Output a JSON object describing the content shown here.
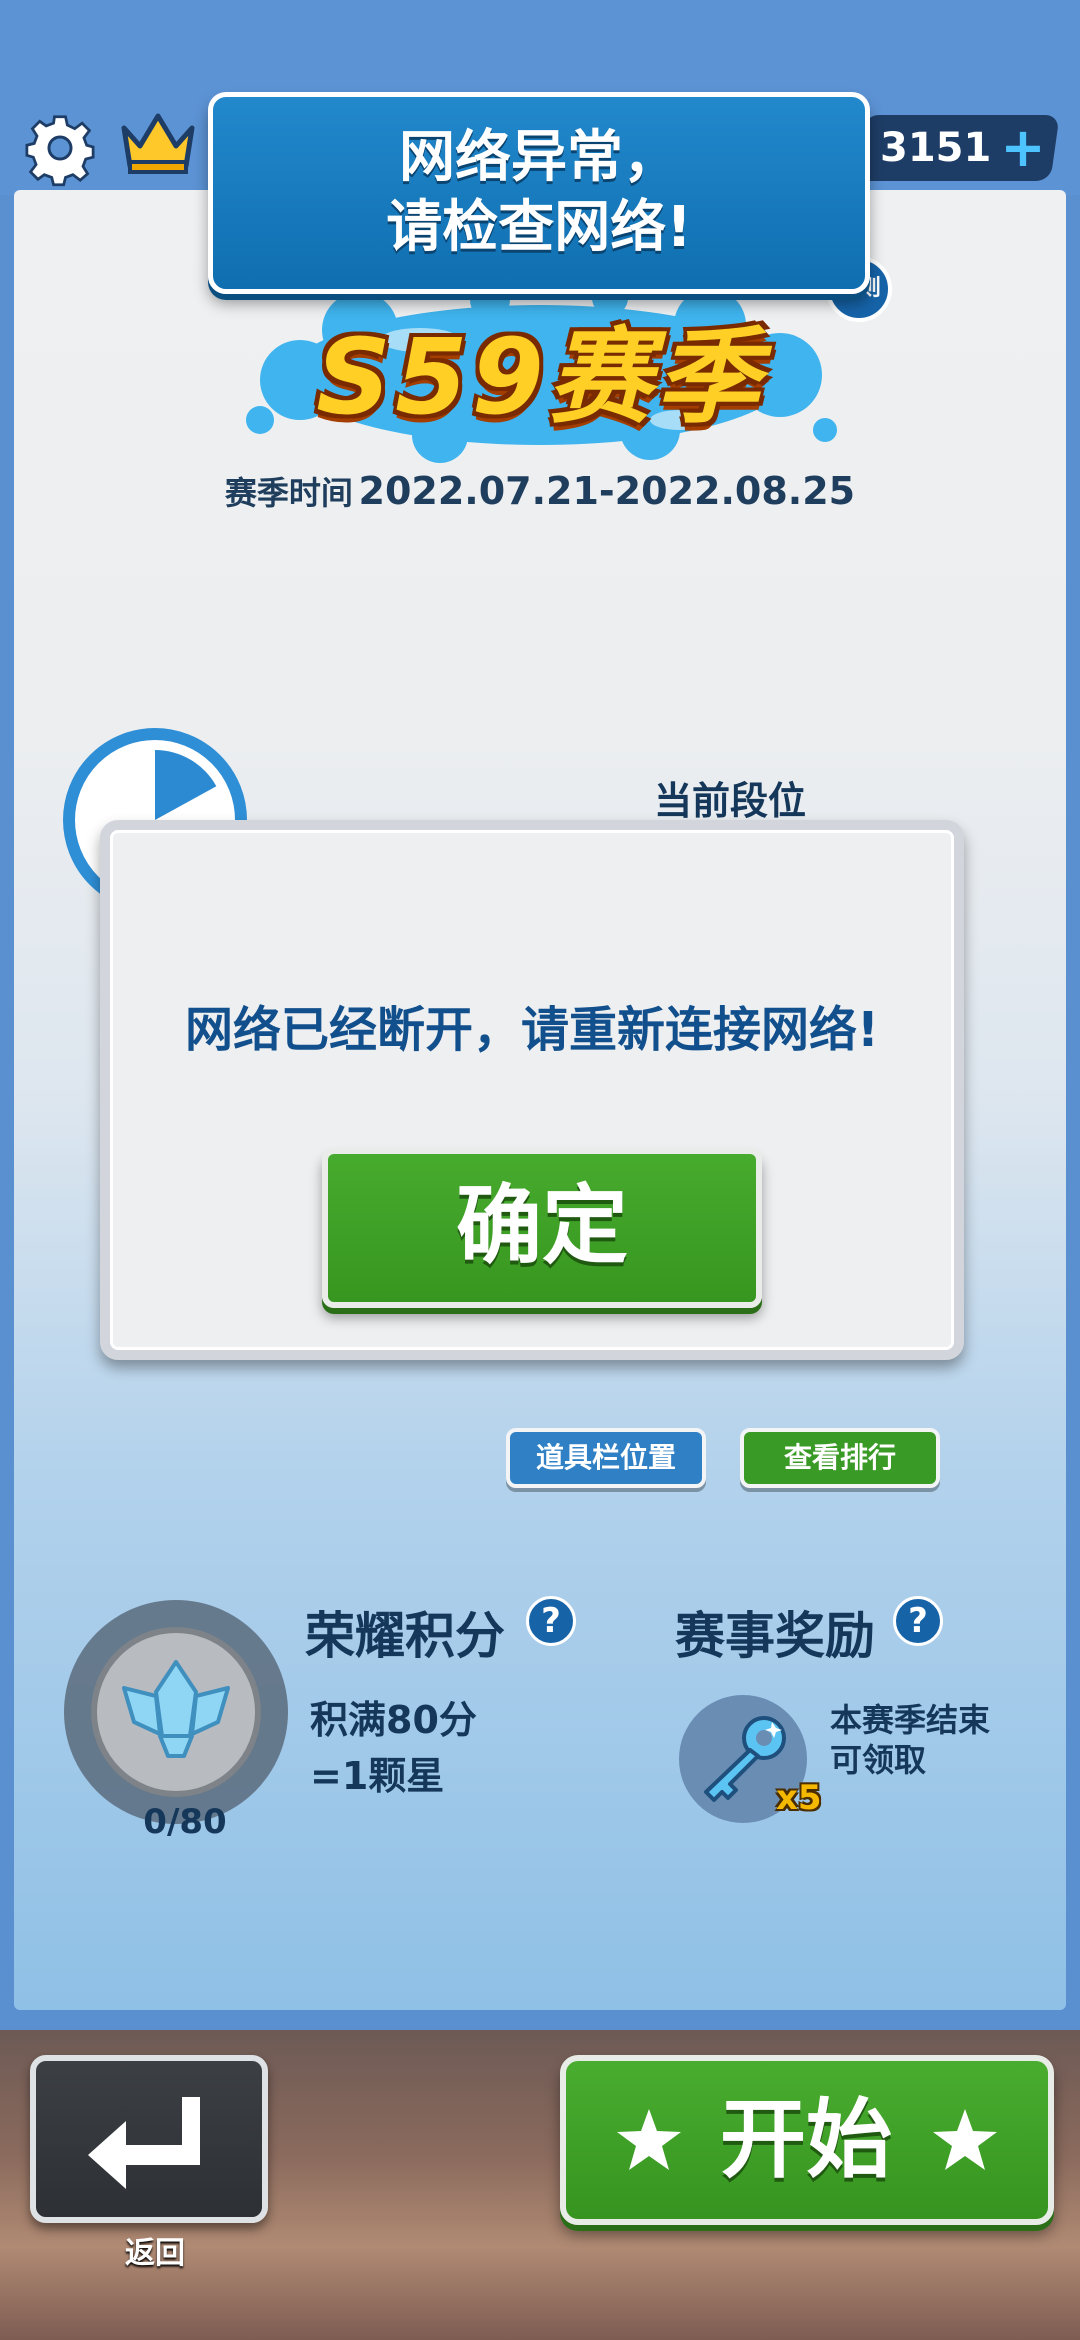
{
  "header": {
    "currency_value": "3151",
    "currency_plus": "+"
  },
  "network_banner": {
    "text": "网络异常，\n请检查网络!"
  },
  "season": {
    "label": "S59赛季",
    "rules_badge": "规则",
    "time_label": "赛季时间",
    "time_range": "2022.07.21-2022.08.25"
  },
  "rank": {
    "current_label": "当前段位",
    "ring_fill_fraction": 0.17
  },
  "dialog": {
    "message": "网络已经断开，请重新连接网络!",
    "confirm_label": "确定"
  },
  "buttons": {
    "toolbar_position": "道具栏位置",
    "view_ranking": "查看排行"
  },
  "honor": {
    "title": "荣耀积分",
    "help": "?",
    "description": "积满80分\n=1颗星",
    "progress": "0/80"
  },
  "reward": {
    "title": "赛事奖励",
    "help": "?",
    "quantity": "x5",
    "description": "本赛季结束\n可领取"
  },
  "footer": {
    "back_label": "返回",
    "start_label": "开始"
  },
  "colors": {
    "primary_blue": "#1663a8",
    "banner_blue": "#0f6eb0",
    "button_green": "#37961f",
    "text_navy": "#14375a",
    "gold": "#ffcf26"
  },
  "icons": [
    "gear-icon",
    "crown-icon",
    "plus-icon",
    "question-icon",
    "medal-icon",
    "key-icon",
    "return-arrow-icon",
    "star-icon"
  ]
}
